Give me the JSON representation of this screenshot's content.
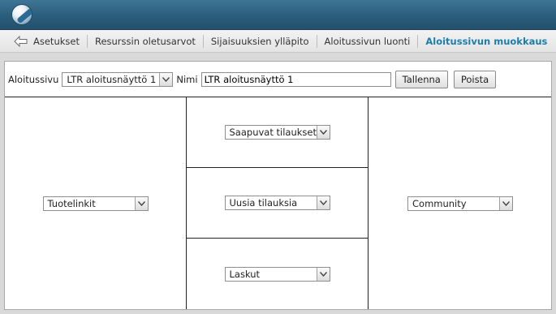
{
  "menu": {
    "items": [
      {
        "label": "Asetukset",
        "active": false
      },
      {
        "label": "Resurssin oletusarvot",
        "active": false
      },
      {
        "label": "Sijaisuuksien ylläpito",
        "active": false
      },
      {
        "label": "Aloitussivun luonti",
        "active": false
      },
      {
        "label": "Aloitussivun muokkaus",
        "active": true
      }
    ]
  },
  "toolbar": {
    "page_label": "Aloitussivu",
    "page_select_value": "LTR aloitusnäyttö 1",
    "name_label": "Nimi",
    "name_value": "LTR aloitusnäyttö 1",
    "save_label": "Tallenna",
    "delete_label": "Poista"
  },
  "layout": {
    "left": {
      "value": "Tuotelinkit"
    },
    "middle": [
      {
        "value": "Saapuvat tilaukset"
      },
      {
        "value": "Uusia tilauksia"
      },
      {
        "value": "Laskut"
      }
    ],
    "right": {
      "value": "Community"
    }
  },
  "colors": {
    "header": "#2a5d7c",
    "active_menu": "#1d7dac"
  }
}
